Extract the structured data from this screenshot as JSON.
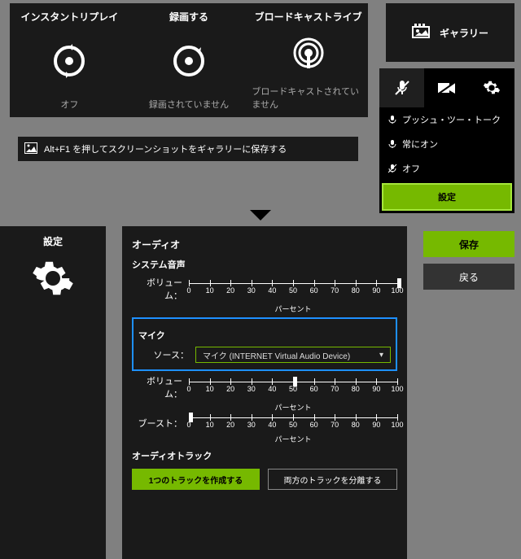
{
  "overlay": {
    "cards": [
      {
        "title": "インスタントリプレイ",
        "status": "オフ"
      },
      {
        "title": "録画する",
        "status": "録画されていません"
      },
      {
        "title": "ブロードキャストライブ",
        "status": "ブロードキャストされていません"
      }
    ],
    "gallery": "ギャラリー",
    "hint": "Alt+F1 を押してスクリーンショットをギャラリーに保存する",
    "menu": {
      "items": [
        "プッシュ・ツー・トーク",
        "常にオン",
        "オフ"
      ],
      "settings": "設定"
    }
  },
  "settings": {
    "leftLabel": "設定",
    "save": "保存",
    "back": "戻る",
    "audio": {
      "heading": "オーディオ",
      "system": "システム音声",
      "volume": "ボリューム：",
      "percent": "パーセント",
      "mic": "マイク",
      "source": "ソース：",
      "sourceValue": "マイク (INTERNET Virtual Audio Device)",
      "boost": "ブースト：",
      "track": "オーディオトラック",
      "single": "1つのトラックを作成する",
      "split": "両方のトラックを分離する"
    },
    "volumeTicks": [
      "0",
      "10",
      "20",
      "30",
      "40",
      "50",
      "60",
      "70",
      "80",
      "90",
      "100"
    ],
    "systemVolume": 100,
    "micVolume": 50,
    "boost": 0
  }
}
